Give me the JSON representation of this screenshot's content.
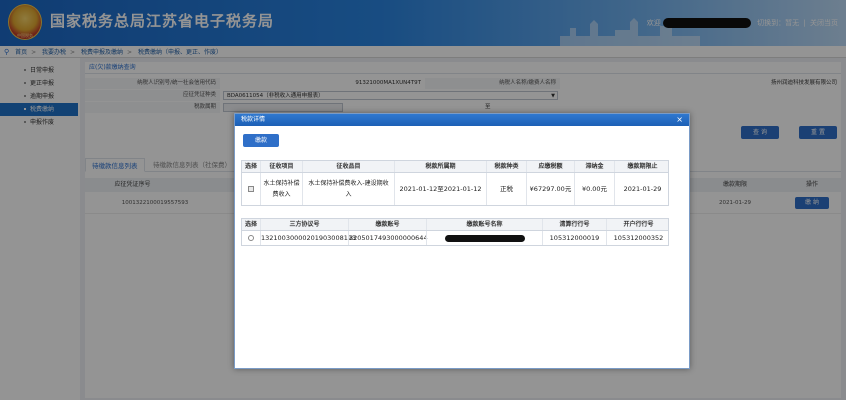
{
  "header": {
    "logo_text": "中国税务",
    "title": "国家税务总局江苏省电子税务局",
    "welcome": "欢迎",
    "links": [
      "切换到",
      "暂无",
      "关闭当页"
    ]
  },
  "breadcrumb": [
    "首页",
    "我要办税",
    "税费申报及缴纳",
    "税费缴纳（申报、更正、作废）"
  ],
  "sidebar": {
    "items": [
      {
        "label": "日常申报",
        "active": false
      },
      {
        "label": "更正申报",
        "active": false
      },
      {
        "label": "逾期申报",
        "active": false
      },
      {
        "label": "税费缴纳",
        "active": true
      },
      {
        "label": "申报作废",
        "active": false
      }
    ]
  },
  "panel": {
    "tab_label": "应(欠)款缴纳查询",
    "rows": {
      "taxpayer_id_label": "纳税人识别号/统一社会信用代码",
      "taxpayer_id_value": "91321000MA1XUN4T9T",
      "taxpayer_name_label": "纳税人名称/缴费人名称",
      "taxpayer_name_value": "扬州润迪科技发展有限公司",
      "voucher_label": "应征凭证种类",
      "voucher_value": "BDA0611054（非税收入通用申报表）",
      "tax_period_label": "税款属期",
      "date_sep": "至"
    },
    "query_button": "查 询",
    "reset_button": "重 置",
    "tabs": [
      "待缴款信息列表",
      "待缴款信息列表（社保费）"
    ],
    "table_headers": [
      "应征凭证序号",
      "缴款期限",
      "操作"
    ],
    "table_row": {
      "voucher_no": "10013221000195575​93",
      "deadline": "2021-01-29",
      "action": "缴 纳"
    }
  },
  "modal": {
    "title": "税款详情",
    "close": "×",
    "pay_button": "缴款",
    "detail_headers": [
      "选择",
      "征收项目",
      "征收品目",
      "税款所属期",
      "税款种类",
      "应缴税额",
      "滞纳金",
      "缴款期限止"
    ],
    "detail_row": {
      "item": "水土保持补偿费收入",
      "sub_item": "水土保持补偿费收入-建设期收入",
      "period": "2021-01-12至2021-01-12",
      "tax_type": "正税",
      "amount": "¥67297.00元",
      "late_fee": "¥0.00元",
      "deadline": "2021-01-29"
    },
    "account_headers": [
      "选择",
      "三方协议号",
      "缴款账号",
      "缴款账号名称",
      "清算行行号",
      "开户行行号"
    ],
    "account_row": {
      "agreement_no": "13210030000201903008193",
      "account_no": "3205017493000000644",
      "clearing_bank": "105312000019",
      "open_bank": "105312000352"
    }
  }
}
